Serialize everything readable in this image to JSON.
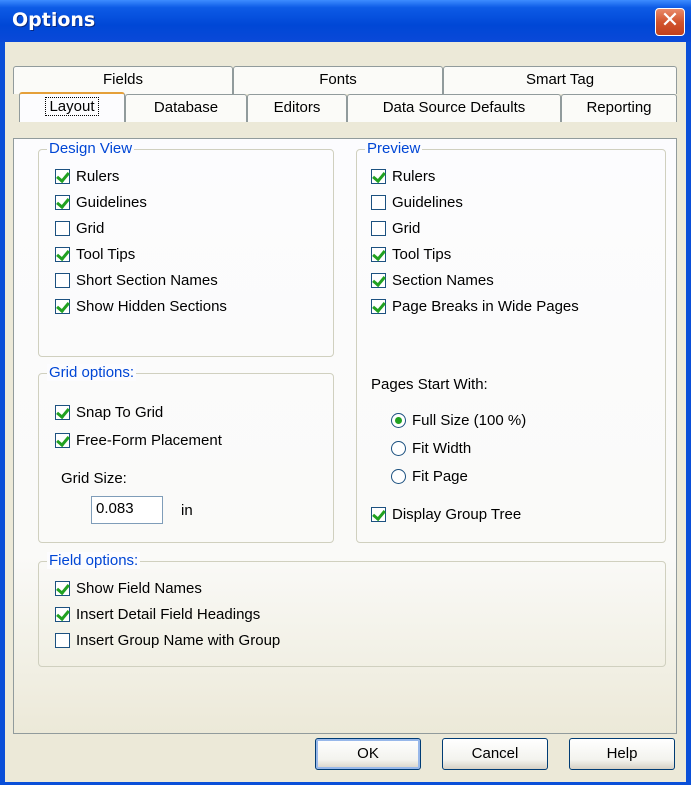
{
  "window": {
    "title": "Options",
    "close_glyph": "✕"
  },
  "tabs": {
    "row_top": [
      "Fields",
      "Fonts",
      "Smart Tag"
    ],
    "row_bottom": [
      "Layout",
      "Database",
      "Editors",
      "Data Source Defaults",
      "Reporting"
    ],
    "active": "Layout"
  },
  "design_view": {
    "title": "Design View",
    "items": [
      {
        "label": "Rulers",
        "checked": true
      },
      {
        "label": "Guidelines",
        "checked": true
      },
      {
        "label": "Grid",
        "checked": false
      },
      {
        "label": "Tool Tips",
        "checked": true
      },
      {
        "label": "Short Section Names",
        "checked": false
      },
      {
        "label": "Show Hidden Sections",
        "checked": true
      }
    ]
  },
  "preview": {
    "title": "Preview",
    "items": [
      {
        "label": "Rulers",
        "checked": true
      },
      {
        "label": "Guidelines",
        "checked": false
      },
      {
        "label": "Grid",
        "checked": false
      },
      {
        "label": "Tool Tips",
        "checked": true
      },
      {
        "label": "Section Names",
        "checked": true
      },
      {
        "label": "Page Breaks in Wide Pages",
        "checked": true
      }
    ],
    "pages_start_label": "Pages Start With:",
    "radios": [
      {
        "label": "Full Size (100 %)",
        "selected": true
      },
      {
        "label": "Fit Width",
        "selected": false
      },
      {
        "label": "Fit Page",
        "selected": false
      }
    ],
    "display_group_tree": {
      "label": "Display Group Tree",
      "checked": true
    }
  },
  "grid_options": {
    "title": "Grid options:",
    "items": [
      {
        "label": "Snap To Grid",
        "checked": true
      },
      {
        "label": "Free-Form Placement",
        "checked": true
      }
    ],
    "grid_size_label": "Grid Size:",
    "grid_size_value": "0.083",
    "grid_size_unit": "in"
  },
  "field_options": {
    "title": "Field options:",
    "items": [
      {
        "label": "Show Field Names",
        "checked": true
      },
      {
        "label": "Insert Detail Field Headings",
        "checked": true
      },
      {
        "label": "Insert Group Name with Group",
        "checked": false
      }
    ]
  },
  "buttons": {
    "ok": "OK",
    "cancel": "Cancel",
    "help": "Help"
  },
  "colors": {
    "accent": "#0046d5",
    "check": "#21a121",
    "title_bar": "#0a49d8",
    "close": "#d2552e"
  }
}
